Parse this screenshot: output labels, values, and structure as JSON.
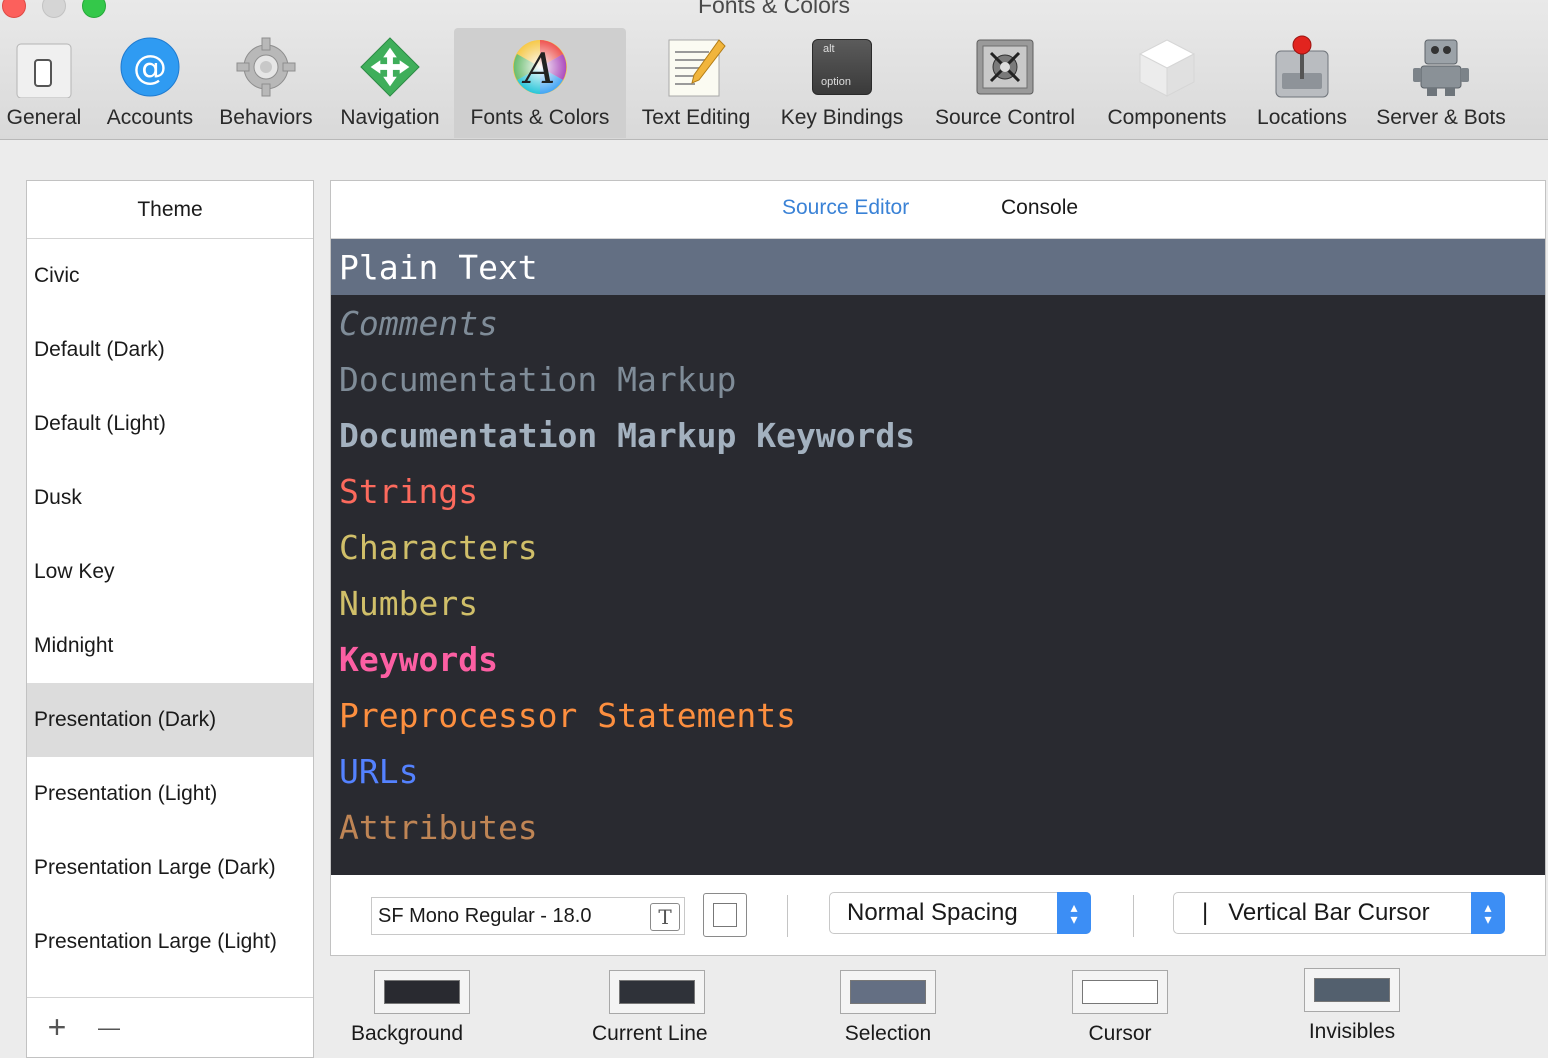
{
  "window": {
    "title": "Fonts & Colors"
  },
  "toolbar": {
    "items": [
      {
        "label": "General",
        "icon": "general-icon"
      },
      {
        "label": "Accounts",
        "icon": "accounts-icon"
      },
      {
        "label": "Behaviors",
        "icon": "behaviors-icon"
      },
      {
        "label": "Navigation",
        "icon": "navigation-icon"
      },
      {
        "label": "Fonts & Colors",
        "icon": "fonts-colors-icon",
        "active": true
      },
      {
        "label": "Text Editing",
        "icon": "text-editing-icon"
      },
      {
        "label": "Key Bindings",
        "icon": "key-bindings-icon"
      },
      {
        "label": "Source Control",
        "icon": "source-control-icon"
      },
      {
        "label": "Components",
        "icon": "components-icon"
      },
      {
        "label": "Locations",
        "icon": "locations-icon"
      },
      {
        "label": "Server & Bots",
        "icon": "server-bots-icon"
      }
    ],
    "key_icon_top": "alt",
    "key_icon_bottom": "option"
  },
  "theme_panel": {
    "header": "Theme",
    "items": [
      "Civic",
      "Default (Dark)",
      "Default (Light)",
      "Dusk",
      "Low Key",
      "Midnight",
      "Presentation (Dark)",
      "Presentation (Light)",
      "Presentation Large (Dark)",
      "Presentation Large (Light)"
    ],
    "selected": "Presentation (Dark)",
    "add_label": "+",
    "remove_label": "—"
  },
  "editor": {
    "tabs": [
      {
        "label": "Source Editor",
        "active": true
      },
      {
        "label": "Console",
        "active": false
      }
    ],
    "syntax_items": [
      {
        "label": "Plain Text",
        "color": "#ffffff",
        "selected": true
      },
      {
        "label": "Comments",
        "color": "#7f8c98",
        "style": "italic"
      },
      {
        "label": "Documentation Markup",
        "color": "#7f8c98"
      },
      {
        "label": "Documentation Markup Keywords",
        "color": "#a3b1bf",
        "weight": "bold"
      },
      {
        "label": "Strings",
        "color": "#fc6a5d"
      },
      {
        "label": "Characters",
        "color": "#d0bf69"
      },
      {
        "label": "Numbers",
        "color": "#d0bf69"
      },
      {
        "label": "Keywords",
        "color": "#fc5fa3",
        "weight": "bold"
      },
      {
        "label": "Preprocessor Statements",
        "color": "#fd8f3f"
      },
      {
        "label": "URLs",
        "color": "#5482ff"
      },
      {
        "label": "Attributes",
        "color": "#bf8555"
      }
    ],
    "font_field": "SF Mono Regular - 18.0",
    "spacing_popup": "Normal Spacing",
    "cursor_popup": "Vertical Bar Cursor",
    "cursor_glyph": "|"
  },
  "swatches": [
    {
      "label": "Background",
      "color": "#292a30"
    },
    {
      "label": "Current Line",
      "color": "#2f3239"
    },
    {
      "label": "Selection",
      "color": "#646f83"
    },
    {
      "label": "Cursor",
      "color": "#ffffff"
    },
    {
      "label": "Invisibles",
      "color": "#53606e"
    }
  ],
  "colors": {
    "accent": "#3a82d6",
    "editor_background": "#292a30",
    "selected_line": "#636f83",
    "popup_stepper": "#3c8ef5"
  }
}
